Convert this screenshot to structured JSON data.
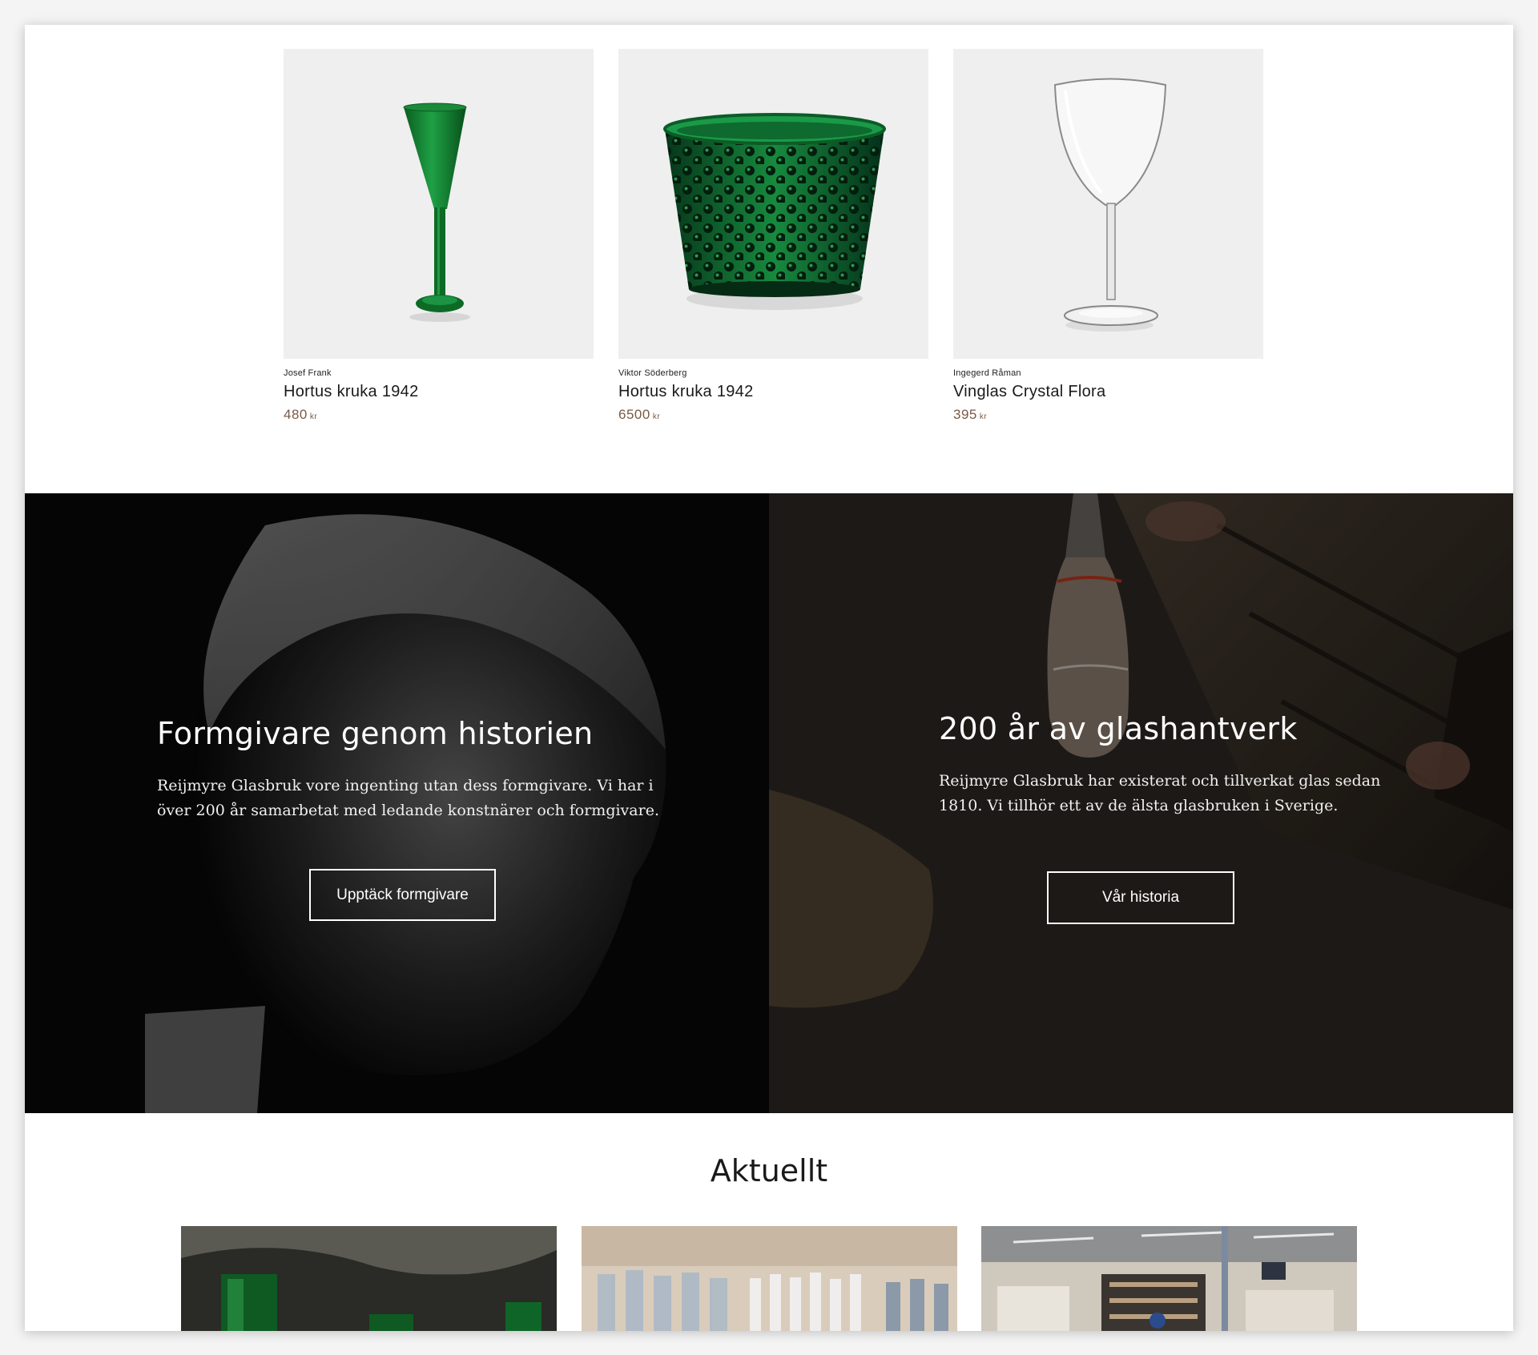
{
  "products": [
    {
      "designer": "Josef Frank",
      "name": "Hortus kruka 1942",
      "price": "480",
      "currency": "kr",
      "image": "green-flute-glass"
    },
    {
      "designer": "Viktor Söderberg",
      "name": "Hortus kruka 1942",
      "price": "6500",
      "currency": "kr",
      "image": "green-hobnail-bowl"
    },
    {
      "designer": "Ingegerd Råman",
      "name": "Vinglas Crystal Flora",
      "price": "395",
      "currency": "kr",
      "image": "clear-wine-glass"
    }
  ],
  "banners": [
    {
      "title": "Formgivare genom historien",
      "text_line1": "Reijmyre Glasbruk vore ingenting utan dess formgivare. Vi har i",
      "text_line2": "över 200 år samarbetat med ledande konstnärer och formgivare.",
      "button": "Upptäck formgivare"
    },
    {
      "title": "200 år av glashantverk",
      "text_line1": "Reijmyre Glasbruk har existerat och tillverkat glas sedan",
      "text_line2": "1810. Vi tillhör ett av de älsta glasbruken i Sverige.",
      "button": "Vår historia"
    }
  ],
  "news": {
    "title": "Aktuellt",
    "cards": [
      {
        "image": "green-glass-outdoor-photo"
      },
      {
        "image": "glassware-shelf-photo"
      },
      {
        "image": "glass-shop-interior-photo"
      }
    ]
  },
  "colors": {
    "price": "#7a5a44",
    "product_bg": "#efefef",
    "glass_green": "#0f7a2a"
  }
}
